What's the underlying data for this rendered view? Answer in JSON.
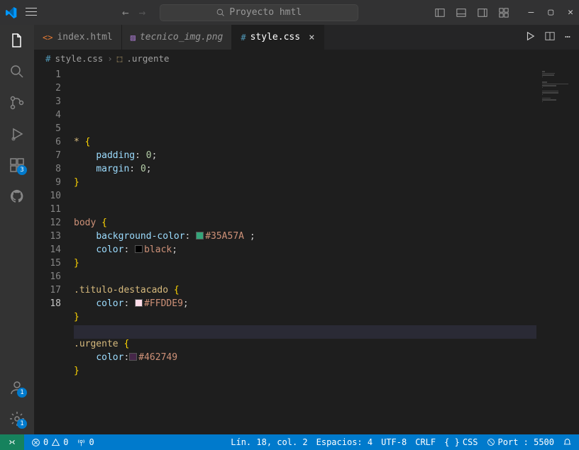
{
  "titlebar": {
    "search_placeholder": "Proyecto hmtl"
  },
  "activitybar": {
    "extensions_badge": "3",
    "account_badge": "1",
    "settings_badge": "1"
  },
  "tabs": [
    {
      "label": "index.html",
      "icon_color": "#e37933",
      "active": false,
      "italic": false
    },
    {
      "label": "tecnico_img.png",
      "icon_color": "#a074c4",
      "active": false,
      "italic": true
    },
    {
      "label": "style.css",
      "icon_color": "#519aba",
      "active": true,
      "italic": false
    }
  ],
  "breadcrumbs": {
    "file": "style.css",
    "symbol": ".urgente"
  },
  "editor": {
    "active_line": 18,
    "lines": [
      {
        "n": 1,
        "text": "* {",
        "seg": [
          [
            "*",
            "sel"
          ],
          [
            " ",
            ""
          ],
          [
            "{",
            "brace"
          ]
        ]
      },
      {
        "n": 2,
        "text": "    padding: 0;",
        "seg": [
          [
            "    ",
            ""
          ],
          [
            "padding",
            "prop"
          ],
          [
            ": ",
            "punc"
          ],
          [
            "0",
            "num"
          ],
          [
            ";",
            "punc"
          ]
        ]
      },
      {
        "n": 3,
        "text": "    margin: 0;",
        "seg": [
          [
            "    ",
            ""
          ],
          [
            "margin",
            "prop"
          ],
          [
            ": ",
            "punc"
          ],
          [
            "0",
            "num"
          ],
          [
            ";",
            "punc"
          ]
        ]
      },
      {
        "n": 4,
        "text": "}",
        "seg": [
          [
            "}",
            "brace"
          ]
        ]
      },
      {
        "n": 5,
        "text": "",
        "seg": []
      },
      {
        "n": 6,
        "text": "",
        "seg": []
      },
      {
        "n": 7,
        "text": "body {",
        "seg": [
          [
            "body",
            "kw"
          ],
          [
            " ",
            ""
          ],
          [
            "{",
            "brace"
          ]
        ]
      },
      {
        "n": 8,
        "text": "    background-color: #35A57A ;",
        "seg": [
          [
            "    ",
            ""
          ],
          [
            "background-color",
            "prop"
          ],
          [
            ": ",
            "punc"
          ],
          [
            "SW#35A57A",
            ""
          ],
          [
            "#35A57A",
            "hex"
          ],
          [
            " ;",
            "punc"
          ]
        ]
      },
      {
        "n": 9,
        "text": "    color: black;",
        "seg": [
          [
            "    ",
            ""
          ],
          [
            "color",
            "prop"
          ],
          [
            ": ",
            "punc"
          ],
          [
            "SW#000000",
            ""
          ],
          [
            "black",
            "hex"
          ],
          [
            ";",
            "punc"
          ]
        ]
      },
      {
        "n": 10,
        "text": "}",
        "seg": [
          [
            "}",
            "brace"
          ]
        ]
      },
      {
        "n": 11,
        "text": "",
        "seg": []
      },
      {
        "n": 12,
        "text": ".titulo-destacado {",
        "seg": [
          [
            ".titulo-destacado",
            "sel"
          ],
          [
            " ",
            ""
          ],
          [
            "{",
            "brace"
          ]
        ]
      },
      {
        "n": 13,
        "text": "    color: #FFDDE9;",
        "seg": [
          [
            "    ",
            ""
          ],
          [
            "color",
            "prop"
          ],
          [
            ": ",
            "punc"
          ],
          [
            "SW#FFDDE9",
            ""
          ],
          [
            "#FFDDE9",
            "hex"
          ],
          [
            ";",
            "punc"
          ]
        ]
      },
      {
        "n": 14,
        "text": "}",
        "seg": [
          [
            "}",
            "brace"
          ]
        ]
      },
      {
        "n": 15,
        "text": "",
        "seg": []
      },
      {
        "n": 16,
        "text": ".urgente {",
        "seg": [
          [
            ".urgente",
            "sel"
          ],
          [
            " ",
            ""
          ],
          [
            "{",
            "brace"
          ]
        ]
      },
      {
        "n": 17,
        "text": "    color:#462749",
        "seg": [
          [
            "    ",
            ""
          ],
          [
            "color",
            "prop"
          ],
          [
            ":",
            "punc"
          ],
          [
            "SW#462749",
            ""
          ],
          [
            "#462749",
            "hex"
          ]
        ]
      },
      {
        "n": 18,
        "text": "}",
        "seg": [
          [
            "}",
            "brace"
          ]
        ]
      }
    ]
  },
  "statusbar": {
    "errors": "0",
    "warnings": "0",
    "port_icon": "0",
    "cursor": "Lín. 18, col. 2",
    "spaces": "Espacios: 4",
    "encoding": "UTF-8",
    "eol": "CRLF",
    "lang": "CSS",
    "port": "Port : 5500"
  }
}
